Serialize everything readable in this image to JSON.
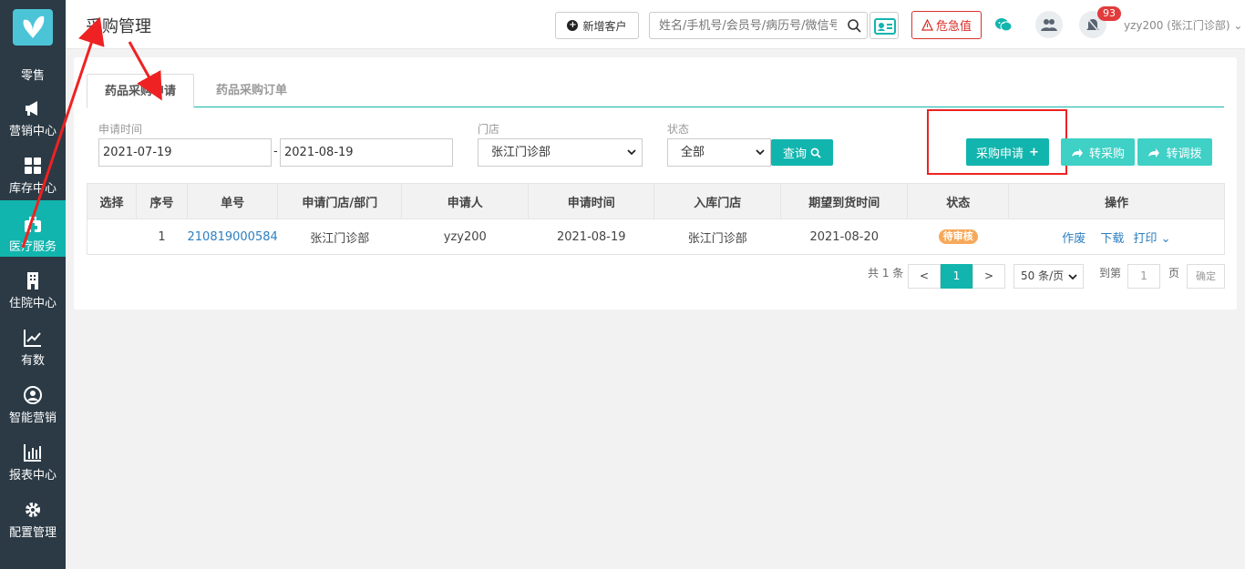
{
  "sidebar": {
    "items": [
      {
        "label": "零售",
        "icon": "butterfly-logo-icon"
      },
      {
        "label": "营销中心",
        "icon": "megaphone-icon"
      },
      {
        "label": "库存中心",
        "icon": "grid-icon"
      },
      {
        "label": "医疗服务",
        "icon": "medkit-icon"
      },
      {
        "label": "住院中心",
        "icon": "hospital-icon"
      },
      {
        "label": "有数",
        "icon": "line-chart-icon"
      },
      {
        "label": "智能营销",
        "icon": "people-icon"
      },
      {
        "label": "报表中心",
        "icon": "bar-chart-icon"
      },
      {
        "label": "配置管理",
        "icon": "gear-icon"
      }
    ]
  },
  "header": {
    "title": "采购管理",
    "add_customer": "新增客户",
    "search_placeholder": "姓名/手机号/会员号/病历号/微信号",
    "danger_value": "危急值",
    "notification_count": "93",
    "user": "yzy200 (张江门诊部)"
  },
  "tabs": [
    "药品采购申请",
    "药品采购订单"
  ],
  "filters": {
    "date_label": "申请时间",
    "date_from": "2021-07-19",
    "date_sep": "-",
    "date_to": "2021-08-19",
    "store_label": "门店",
    "store_value": "张江门诊部",
    "status_label": "状态",
    "status_value": "全部",
    "query_button": "查询"
  },
  "actions": {
    "apply": "采购申请",
    "to_purchase": "转采购",
    "to_transfer": "转调拨"
  },
  "table": {
    "headers": [
      "选择",
      "序号",
      "单号",
      "申请门店/部门",
      "申请人",
      "申请时间",
      "入库门店",
      "期望到货时间",
      "状态",
      "操作"
    ],
    "rows": [
      {
        "select": "",
        "index": "1",
        "number": "210819000584",
        "dept": "张江门诊部",
        "applicant": "yzy200",
        "apply_time": "2021-08-19",
        "store": "张江门诊部",
        "expected": "2021-08-20",
        "status": "待审核",
        "ops": [
          "作废",
          "下载",
          "打印"
        ]
      }
    ]
  },
  "pagination": {
    "total": "共 1 条",
    "prev": "<",
    "current": "1",
    "next": ">",
    "page_size": "50 条/页",
    "goto_label": "到第",
    "goto_value": "1",
    "page_unit": "页",
    "confirm": "确定"
  },
  "colors": {
    "sidebar_bg": "#2b3a45",
    "accent": "#12b5ae",
    "danger": "#d9312b",
    "annotation": "#e22222"
  }
}
